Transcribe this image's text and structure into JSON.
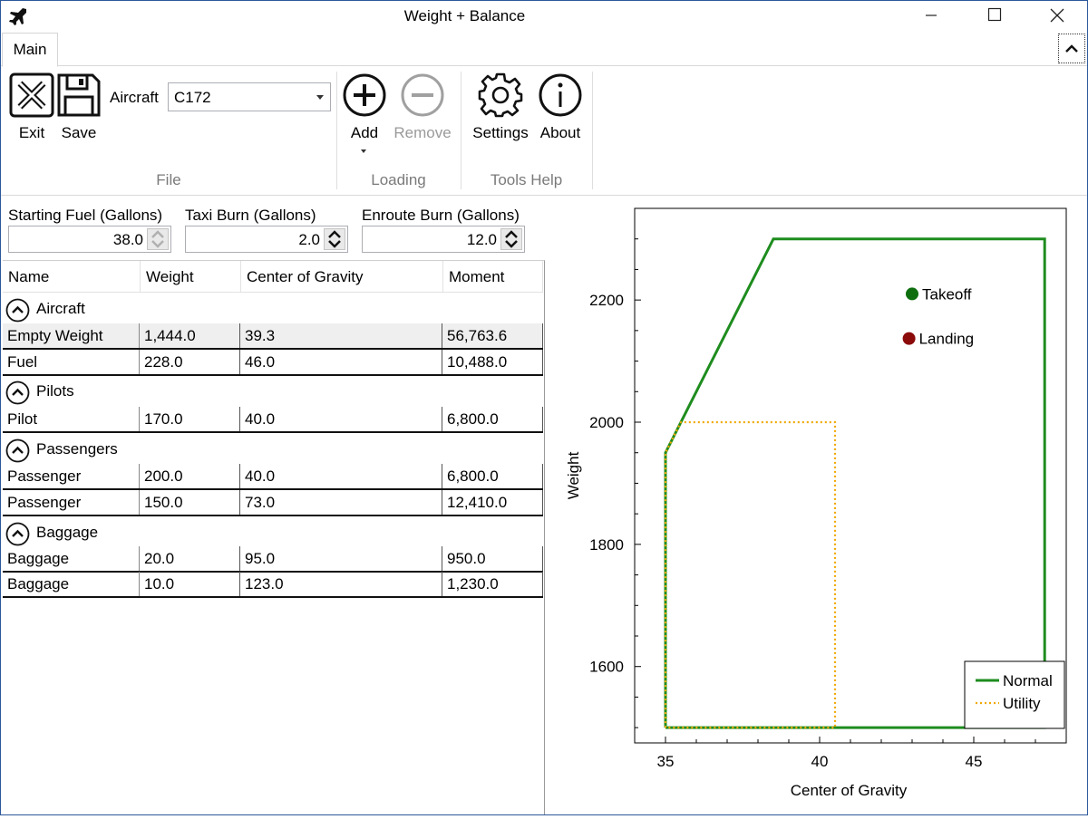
{
  "window": {
    "title": "Weight + Balance"
  },
  "ribbon": {
    "tab": "Main",
    "groups": {
      "file": "File",
      "loading": "Loading",
      "tools_help": "Tools Help"
    },
    "buttons": {
      "exit": "Exit",
      "save": "Save",
      "add": "Add",
      "remove": "Remove",
      "settings": "Settings",
      "about": "About"
    },
    "aircraft_label": "Aircraft",
    "aircraft_value": "C172"
  },
  "fuel": {
    "starting": {
      "label": "Starting Fuel (Gallons)",
      "value": "38.0"
    },
    "taxi": {
      "label": "Taxi Burn (Gallons)",
      "value": "2.0"
    },
    "enroute": {
      "label": "Enroute Burn (Gallons)",
      "value": "12.0"
    }
  },
  "table": {
    "headers": [
      "Name",
      "Weight",
      "Center of Gravity",
      "Moment"
    ],
    "groups": [
      {
        "name": "Aircraft",
        "rows": [
          {
            "name": "Empty Weight",
            "weight": "1,444.0",
            "cg": "39.3",
            "moment": "56,763.6"
          },
          {
            "name": "Fuel",
            "weight": "228.0",
            "cg": "46.0",
            "moment": "10,488.0"
          }
        ]
      },
      {
        "name": "Pilots",
        "rows": [
          {
            "name": "Pilot",
            "weight": "170.0",
            "cg": "40.0",
            "moment": "6,800.0"
          }
        ]
      },
      {
        "name": "Passengers",
        "rows": [
          {
            "name": "Passenger",
            "weight": "200.0",
            "cg": "40.0",
            "moment": "6,800.0"
          },
          {
            "name": "Passenger",
            "weight": "150.0",
            "cg": "73.0",
            "moment": "12,410.0"
          }
        ]
      },
      {
        "name": "Baggage",
        "rows": [
          {
            "name": "Baggage",
            "weight": "20.0",
            "cg": "95.0",
            "moment": "950.0"
          },
          {
            "name": "Baggage",
            "weight": "10.0",
            "cg": "123.0",
            "moment": "1,230.0"
          }
        ]
      }
    ]
  },
  "chart_data": {
    "type": "line",
    "xlabel": "Center of Gravity",
    "ylabel": "Weight",
    "xlim": [
      34.0,
      48.0
    ],
    "ylim": [
      1475,
      2350
    ],
    "xticks": [
      35,
      40,
      45
    ],
    "yticks": [
      1600,
      1800,
      2000,
      2200
    ],
    "grid": false,
    "legend_position": "bottom-right",
    "series": [
      {
        "name": "Normal",
        "color": "#1e8c1e",
        "style": "solid",
        "points": [
          [
            35.0,
            1500
          ],
          [
            35.0,
            1950
          ],
          [
            38.5,
            2300
          ],
          [
            47.3,
            2300
          ],
          [
            47.3,
            1500
          ],
          [
            35.0,
            1500
          ]
        ]
      },
      {
        "name": "Utility",
        "color": "#f0a800",
        "style": "dotted",
        "points": [
          [
            35.0,
            1500
          ],
          [
            35.0,
            1950
          ],
          [
            35.5,
            2000
          ],
          [
            40.5,
            2000
          ],
          [
            40.5,
            1500
          ],
          [
            35.0,
            1500
          ]
        ]
      }
    ],
    "markers": [
      {
        "label": "Takeoff",
        "x": 43.0,
        "y": 2210,
        "color": "#0e6e0e"
      },
      {
        "label": "Landing",
        "x": 42.9,
        "y": 2137,
        "color": "#8b0a0a"
      }
    ]
  }
}
